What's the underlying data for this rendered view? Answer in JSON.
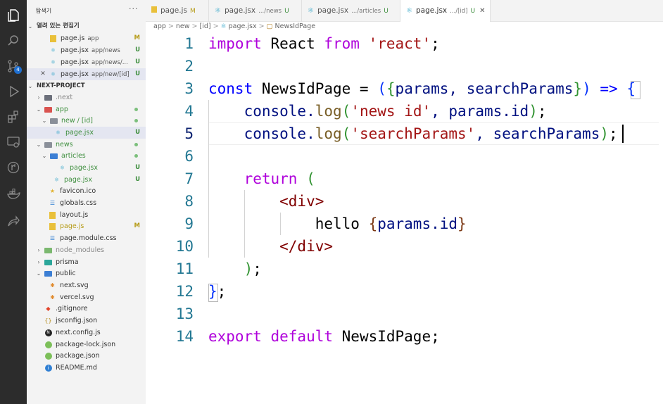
{
  "sidebar": {
    "title": "탐색기",
    "more_label": "···",
    "open_editors": {
      "header": "열려 있는 편집기",
      "items": [
        {
          "name": "page.js",
          "desc": "app",
          "status": "M",
          "icon": "js-icon"
        },
        {
          "name": "page.jsx",
          "desc": "app/news",
          "status": "U",
          "icon": "react-icon"
        },
        {
          "name": "page.jsx",
          "desc": "app/news/...",
          "status": "U",
          "icon": "react-icon"
        },
        {
          "name": "page.jsx",
          "desc": "app/new/[id]",
          "status": "U",
          "icon": "react-icon",
          "close": "✕"
        }
      ]
    },
    "project": {
      "header": "NEXT-PROJECT",
      "items": [
        {
          "name": ".next"
        },
        {
          "name": "app"
        },
        {
          "name": "new / [id]"
        },
        {
          "name": "page.jsx",
          "status": "U"
        },
        {
          "name": "news"
        },
        {
          "name": "articles"
        },
        {
          "name": "page.jsx",
          "status": "U"
        },
        {
          "name": "page.jsx",
          "status": "U"
        },
        {
          "name": "favicon.ico"
        },
        {
          "name": "globals.css"
        },
        {
          "name": "layout.js"
        },
        {
          "name": "page.js",
          "status": "M"
        },
        {
          "name": "page.module.css"
        },
        {
          "name": "node_modules"
        },
        {
          "name": "prisma"
        },
        {
          "name": "public"
        },
        {
          "name": "next.svg"
        },
        {
          "name": "vercel.svg"
        },
        {
          "name": ".gitignore"
        },
        {
          "name": "jsconfig.json"
        },
        {
          "name": "next.config.js"
        },
        {
          "name": "package-lock.json"
        },
        {
          "name": "package.json"
        },
        {
          "name": "README.md"
        }
      ]
    }
  },
  "activity": {
    "scm_badge": "4"
  },
  "tabs": [
    {
      "name": "page.js",
      "desc": "",
      "status": "M"
    },
    {
      "name": "page.jsx",
      "desc": ".../news",
      "status": "U"
    },
    {
      "name": "page.jsx",
      "desc": ".../articles",
      "status": "U"
    },
    {
      "name": "page.jsx",
      "desc": ".../[id]",
      "status": "U",
      "close": "✕"
    }
  ],
  "breadcrumb": [
    "app",
    "new",
    "[id]",
    "page.jsx",
    "NewsIdPage"
  ],
  "breadcrumb_sep": ">",
  "editor": {
    "line_numbers": [
      "1",
      "2",
      "3",
      "4",
      "5",
      "6",
      "7",
      "8",
      "9",
      "10",
      "11",
      "12",
      "13",
      "14"
    ],
    "tokens": {
      "l1_import": "import",
      "l1_react": " React ",
      "l1_from": "from",
      "l1_str": " 'react'",
      "l1_semi": ";",
      "l3_const": "const",
      "l3_name": " NewsIdPage = ",
      "l3_paren": "(",
      "l3_brace": "{",
      "l3_params": "params, searchParams",
      "l3_brace_c": "}",
      "l3_paren_c": ")",
      "l3_arrow": " => ",
      "l3_open": "{",
      "l4_pre": "    console.",
      "l4_log": "log",
      "l4_p": "(",
      "l4_str": "'news id'",
      "l4_mid": ", params.",
      "l4_id": "id",
      "l4_pc": ")",
      "l4_semi": ";",
      "l5_pre": "    console.",
      "l5_log": "log",
      "l5_p": "(",
      "l5_str": "'searchParams'",
      "l5_mid": ", searchParams",
      "l5_pc": ")",
      "l5_semi": ";",
      "l7_return": "    return ",
      "l7_p": "(",
      "l8_tag": "        <div>",
      "l9_hello": "            hello ",
      "l9_b": "{",
      "l9_expr": "params.id",
      "l9_bc": "}",
      "l10_tag": "        </div>",
      "l11_p": "    )",
      "l11_semi": ";",
      "l12_b": "}",
      "l12_semi": ";",
      "l14_export": "export",
      "l14_default": " default",
      "l14_name": " NewsIdPage;"
    }
  },
  "colors": {
    "activity_bg": "#2c2c2c",
    "sidebar_bg": "#f3f3f3",
    "modified": "#b59b16",
    "untracked": "#3f8f3f",
    "keyword": "#0000ff",
    "string": "#a31515"
  }
}
